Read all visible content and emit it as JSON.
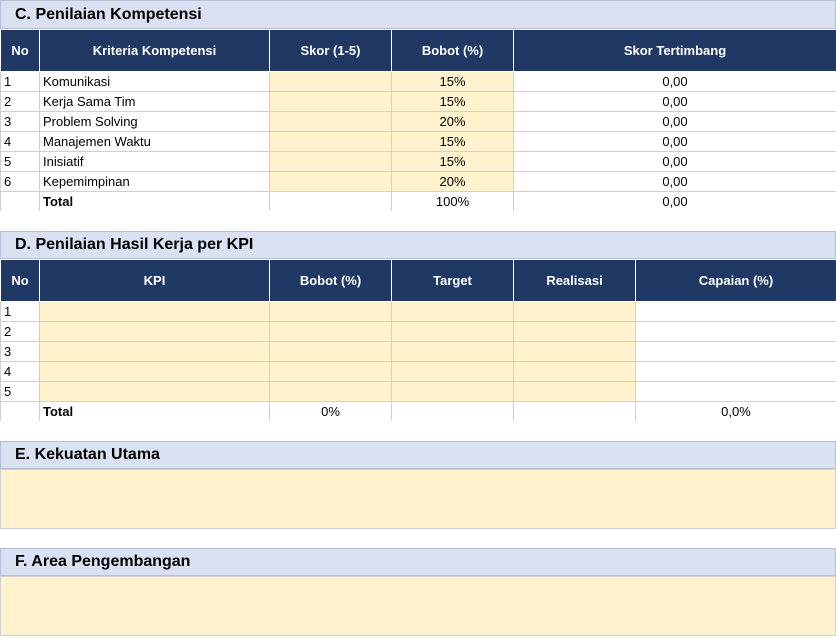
{
  "section_c": {
    "title": "C. Penilaian Kompetensi",
    "headers": [
      "No",
      "Kriteria Kompetensi",
      "Skor (1-5)",
      "Bobot (%)",
      "Skor Tertimbang"
    ],
    "rows": [
      {
        "no": "1",
        "kriteria": "Komunikasi",
        "skor": "",
        "bobot": "15%",
        "tertimbang": "0,00"
      },
      {
        "no": "2",
        "kriteria": "Kerja Sama Tim",
        "skor": "",
        "bobot": "15%",
        "tertimbang": "0,00"
      },
      {
        "no": "3",
        "kriteria": "Problem Solving",
        "skor": "",
        "bobot": "20%",
        "tertimbang": "0,00"
      },
      {
        "no": "4",
        "kriteria": "Manajemen Waktu",
        "skor": "",
        "bobot": "15%",
        "tertimbang": "0,00"
      },
      {
        "no": "5",
        "kriteria": "Inisiatif",
        "skor": "",
        "bobot": "15%",
        "tertimbang": "0,00"
      },
      {
        "no": "6",
        "kriteria": "Kepemimpinan",
        "skor": "",
        "bobot": "20%",
        "tertimbang": "0,00"
      }
    ],
    "total": {
      "label": "Total",
      "bobot": "100%",
      "tertimbang": "0,00"
    }
  },
  "section_d": {
    "title": "D. Penilaian Hasil Kerja per KPI",
    "headers": [
      "No",
      "KPI",
      "Bobot (%)",
      "Target",
      "Realisasi",
      "Capaian (%)"
    ],
    "rows": [
      {
        "no": "1"
      },
      {
        "no": "2"
      },
      {
        "no": "3"
      },
      {
        "no": "4"
      },
      {
        "no": "5"
      }
    ],
    "total": {
      "label": "Total",
      "bobot": "0%",
      "capaian": "0,0%"
    }
  },
  "section_e": {
    "title": "E. Kekuatan Utama"
  },
  "section_f": {
    "title": "F. Area Pengembangan"
  },
  "colors": {
    "header_bg": "#1f3864",
    "section_bg": "#d9e1f2",
    "input_bg": "#fff2cc"
  }
}
